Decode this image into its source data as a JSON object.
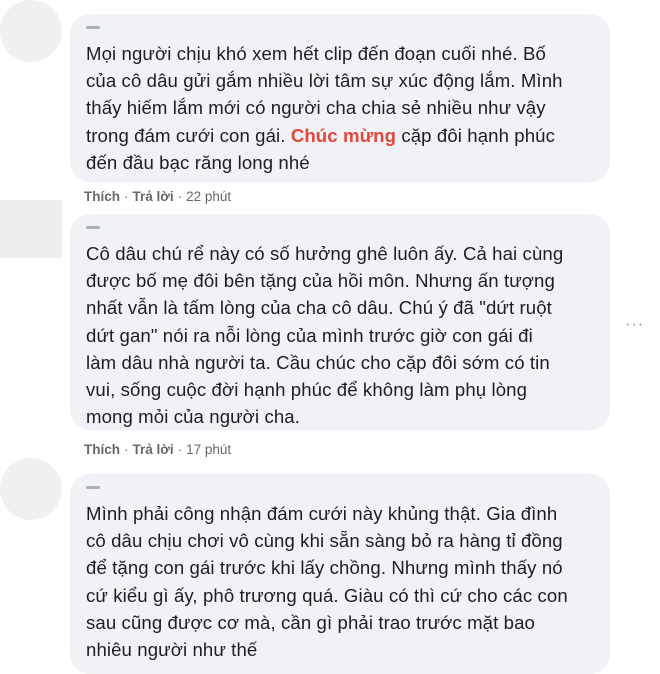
{
  "comments": [
    {
      "text_before": "Mọi người chịu khó xem hết clip đến đoạn cuối nhé. Bố\ncủa cô dâu gửi gắm nhiều lời tâm sự xúc động lắm. Mình\nthấy hiếm lắm mới có người cha chia sẻ nhiều như vậy\ntrong đám cưới con gái. ",
      "highlight": "Chúc mừng",
      "text_after": " cặp đôi hạnh phúc\nđến đầu bạc răng long nhé",
      "like": "Thích",
      "reply": "Trả lời",
      "time": "22 phút"
    },
    {
      "text": "Cô dâu chú rể này có số hưởng ghê luôn ấy. Cả hai cùng\nđược bố mẹ đôi bên tặng của hồi môn. Nhưng ấn tượng\nnhất vẫn là tấm lòng của cha cô dâu. Chú ý đã \"dứt ruột\ndứt gan\" nói ra nỗi lòng của mình trước giờ con gái đi\nlàm dâu nhà người ta. Cầu chúc cho cặp đôi sớm có tin\nvui, sống cuộc đời hạnh phúc để không làm phụ lòng\nmong mỏi của người cha.",
      "like": "Thích",
      "reply": "Trả lời",
      "time": "17 phút"
    },
    {
      "text": "Mình phải công nhận đám cưới này khủng thật. Gia đình\ncô dâu chịu chơi vô cùng khi sẵn sàng bỏ ra hàng tỉ đồng\nđể tặng con gái trước khi lấy chồng. Nhưng mình thấy nó\ncứ kiểu gì ấy, phô trương quá. Giàu có thì cứ cho các con\nsau cũng được cơ mà, cần gì phải trao trước mặt bao\nnhiêu người như thế"
    }
  ],
  "separator": "·",
  "more_icon": "···",
  "colors": {
    "bubble": "#f0f2f5",
    "highlight": "#e2473b",
    "meta": "#65676b"
  }
}
